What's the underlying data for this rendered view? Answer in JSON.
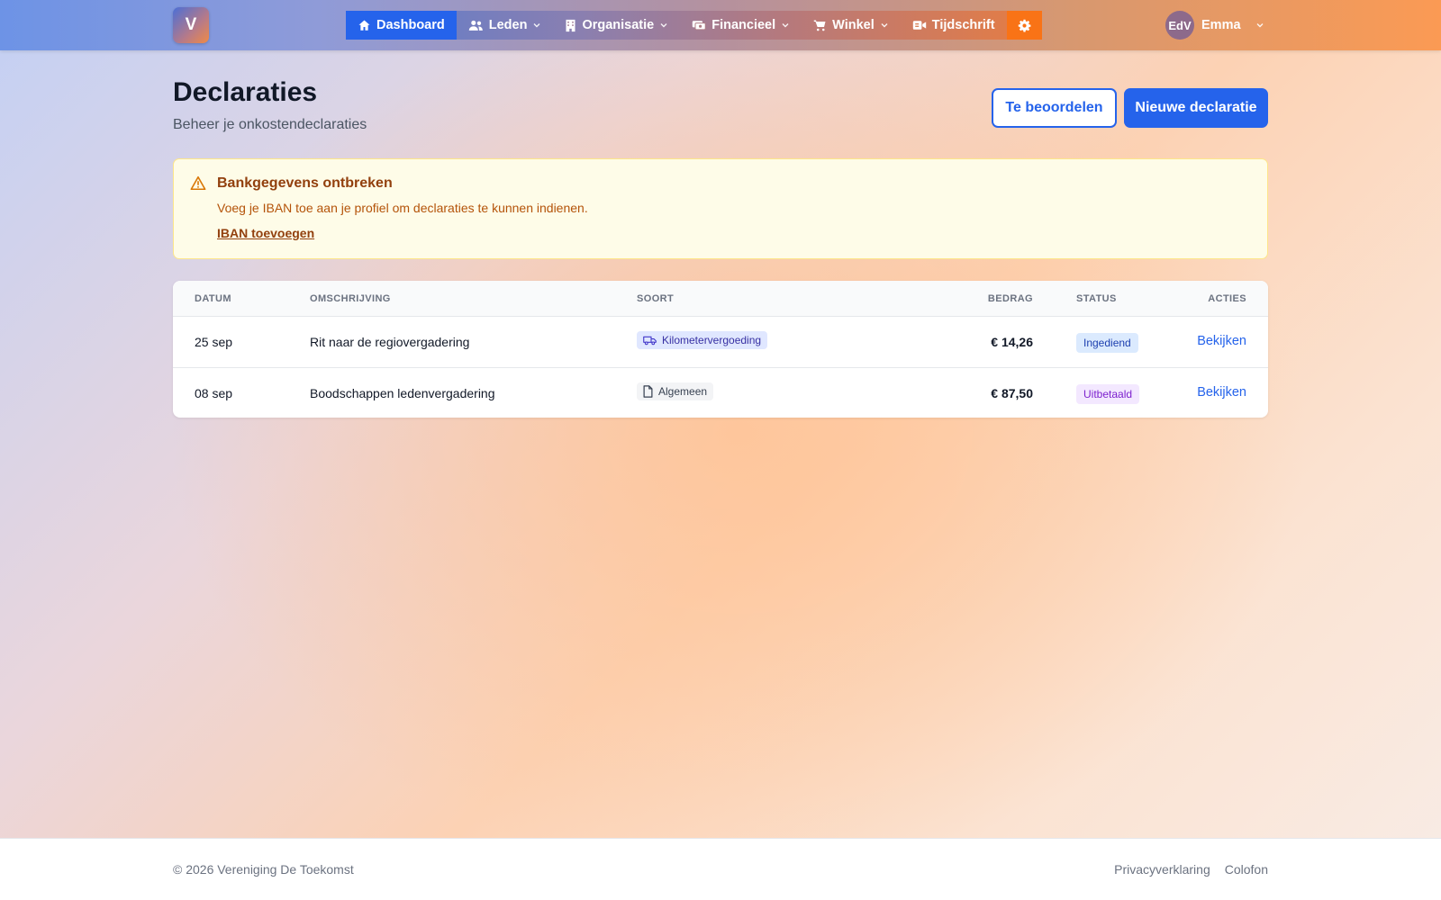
{
  "brand": {
    "logo_letter": "V"
  },
  "nav": {
    "items": [
      {
        "label": "Dashboard",
        "icon": "home-icon",
        "active": true
      },
      {
        "label": "Leden",
        "icon": "users-icon",
        "dropdown": true
      },
      {
        "label": "Organisatie",
        "icon": "building-icon",
        "dropdown": true
      },
      {
        "label": "Financieel",
        "icon": "money-icon",
        "dropdown": true
      },
      {
        "label": "Winkel",
        "icon": "cart-icon",
        "dropdown": true
      },
      {
        "label": "Tijdschrift",
        "icon": "video-icon"
      }
    ],
    "settings_icon": "gear-icon"
  },
  "user": {
    "initials": "EdV",
    "name": "Emma"
  },
  "page": {
    "title": "Declaraties",
    "subtitle": "Beheer je onkostendeclaraties",
    "review_button": "Te beoordelen",
    "new_button": "Nieuwe declaratie"
  },
  "alert": {
    "title": "Bankgegevens ontbreken",
    "text": "Voeg je IBAN toe aan je profiel om declaraties te kunnen indienen.",
    "link": "IBAN toevoegen"
  },
  "table": {
    "headers": {
      "date": "Datum",
      "description": "Omschrijving",
      "type": "Soort",
      "amount": "Bedrag",
      "status": "Status",
      "actions": "Acties"
    },
    "rows": [
      {
        "date": "25 sep",
        "description": "Rit naar de regiovergadering",
        "type": "Kilometervergoeding",
        "type_icon": "truck-icon",
        "amount": "€ 14,26",
        "status": "Ingediend",
        "action": "Bekijken"
      },
      {
        "date": "08 sep",
        "description": "Boodschappen ledenvergadering",
        "type": "Algemeen",
        "type_icon": "document-icon",
        "amount": "€ 87,50",
        "status": "Uitbetaald",
        "action": "Bekijken"
      }
    ]
  },
  "footer": {
    "copyright": "© 2026 Vereniging De Toekomst",
    "links": [
      "Privacyverklaring",
      "Colofon"
    ]
  },
  "colors": {
    "primary": "#2563eb",
    "accent": "#f97316",
    "alert_text": "#92400e"
  }
}
